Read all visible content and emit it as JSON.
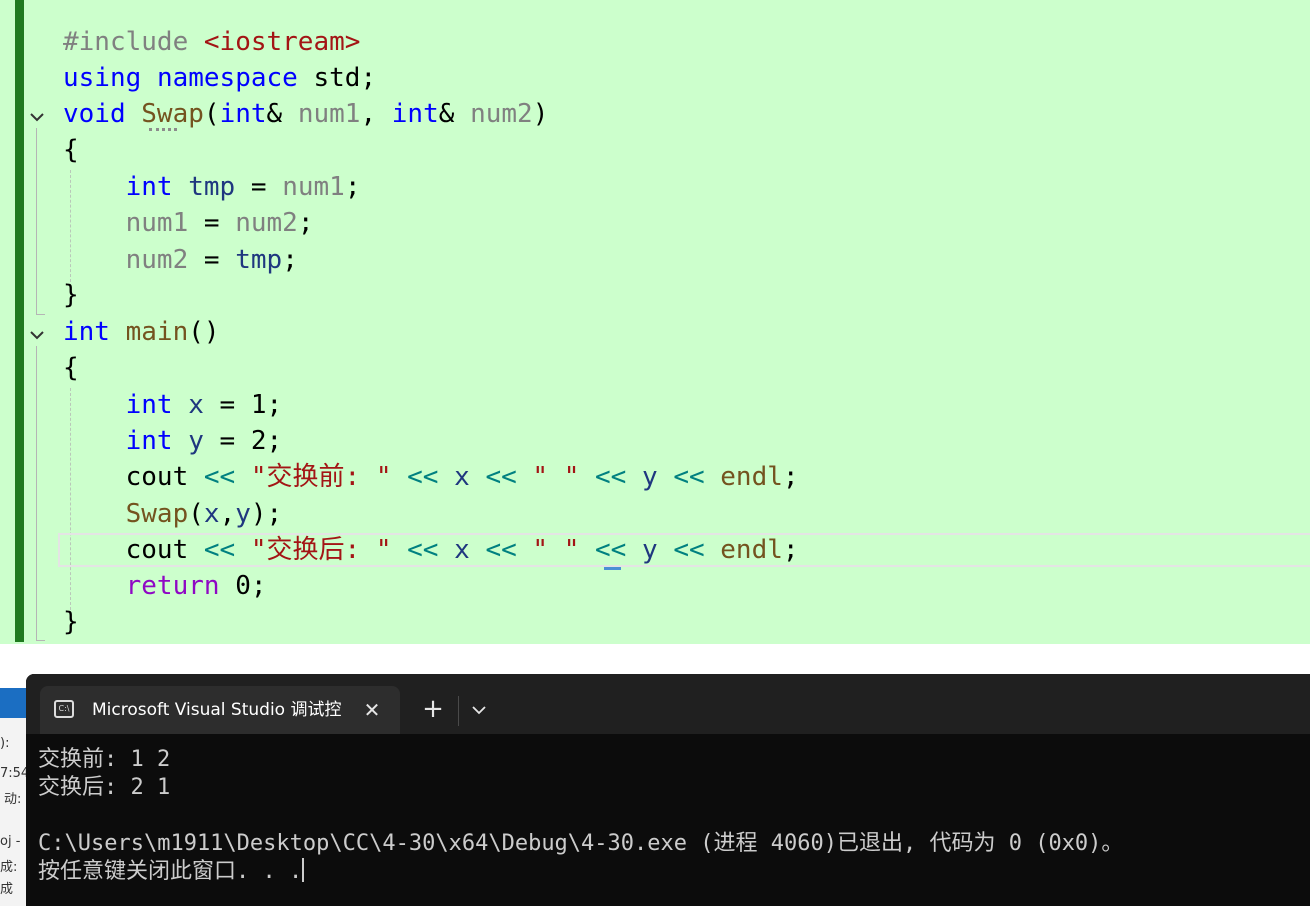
{
  "editor": {
    "line1": {
      "directive": "#include",
      "header": "<iostream>"
    },
    "line2": {
      "kw1": "using",
      "kw2": "namespace",
      "name": "std;"
    },
    "line3": {
      "kw": "void",
      "fn": "Swap",
      "p1": "(",
      "t1": "int",
      "amp1": "& ",
      "a1": "num1",
      ", ": ", ",
      "t2": "int",
      "amp2": "& ",
      "a2": "num2",
      "close": ")"
    },
    "line4": {
      "brace": "{"
    },
    "line5": {
      "kw": "int",
      "var": "tmp",
      "eq": " = ",
      "rhs": "num1",
      "semi": ";"
    },
    "line6": {
      "lhs": "num1",
      "eq": " = ",
      "rhs": "num2",
      "semi": ";"
    },
    "line7": {
      "lhs": "num2",
      "eq": " = ",
      "rhs": "tmp",
      "semi": ";"
    },
    "line8": {
      "brace": "}"
    },
    "line9": {
      "kw": "int",
      "fn": "main",
      "rest": "()"
    },
    "line10": {
      "brace": "{"
    },
    "line11": {
      "kw": "int",
      "var": "x",
      "eq": " = ",
      "val": "1;"
    },
    "line12": {
      "kw": "int",
      "var": "y",
      "eq": " = ",
      "val": "2;"
    },
    "line13": {
      "cout": "cout",
      "op1": "<<",
      "str": "\"交换前: \"",
      "op2": "<<",
      "x": "x",
      "op3": "<<",
      "sp": "\" \"",
      "op4": "<<",
      "y": "y",
      "op5": "<<",
      "endl": "endl",
      "semi": ";"
    },
    "line14": {
      "fn": "Swap",
      "open": "(",
      "x": "x",
      "comma": ",",
      "y": "y",
      "close": ");"
    },
    "line15": {
      "cout": "cout",
      "op1": "<<",
      "str": "\"交换后: \"",
      "op2": "<<",
      "x": "x",
      "op3": "<<",
      "sp": "\" \"",
      "op4": "<<",
      "y": "y",
      "op5": "<<",
      "endl": "endl",
      "semi": ";"
    },
    "line16": {
      "kw": "return",
      "val": "0;"
    },
    "line17": {
      "brace": "}"
    }
  },
  "side_window": {
    "frag1": "):",
    "frag2": "7:54",
    "frag3": "动:",
    "frag4": "oj -",
    "frag5": "成:",
    "frag6": "成"
  },
  "console": {
    "tab_title": "Microsoft Visual Studio 调试控",
    "tab_icon": "C:\\",
    "close_glyph": "✕",
    "new_tab_glyph": "+",
    "output": [
      "交换前: 1 2",
      "交换后: 2 1",
      "",
      "C:\\Users\\m1911\\Desktop\\CC\\4-30\\x64\\Debug\\4-30.exe (进程 4060)已退出, 代码为 0 (0x0)。",
      "按任意键关闭此窗口. . ."
    ]
  },
  "colors": {
    "editor_bg": "#ccffcc",
    "keyword": "#0000ff",
    "string": "#a31515",
    "function": "#74531f",
    "variable": "#1f377f",
    "operator": "#008080",
    "return": "#8f08c4",
    "console_bg": "#0c0c0c"
  }
}
